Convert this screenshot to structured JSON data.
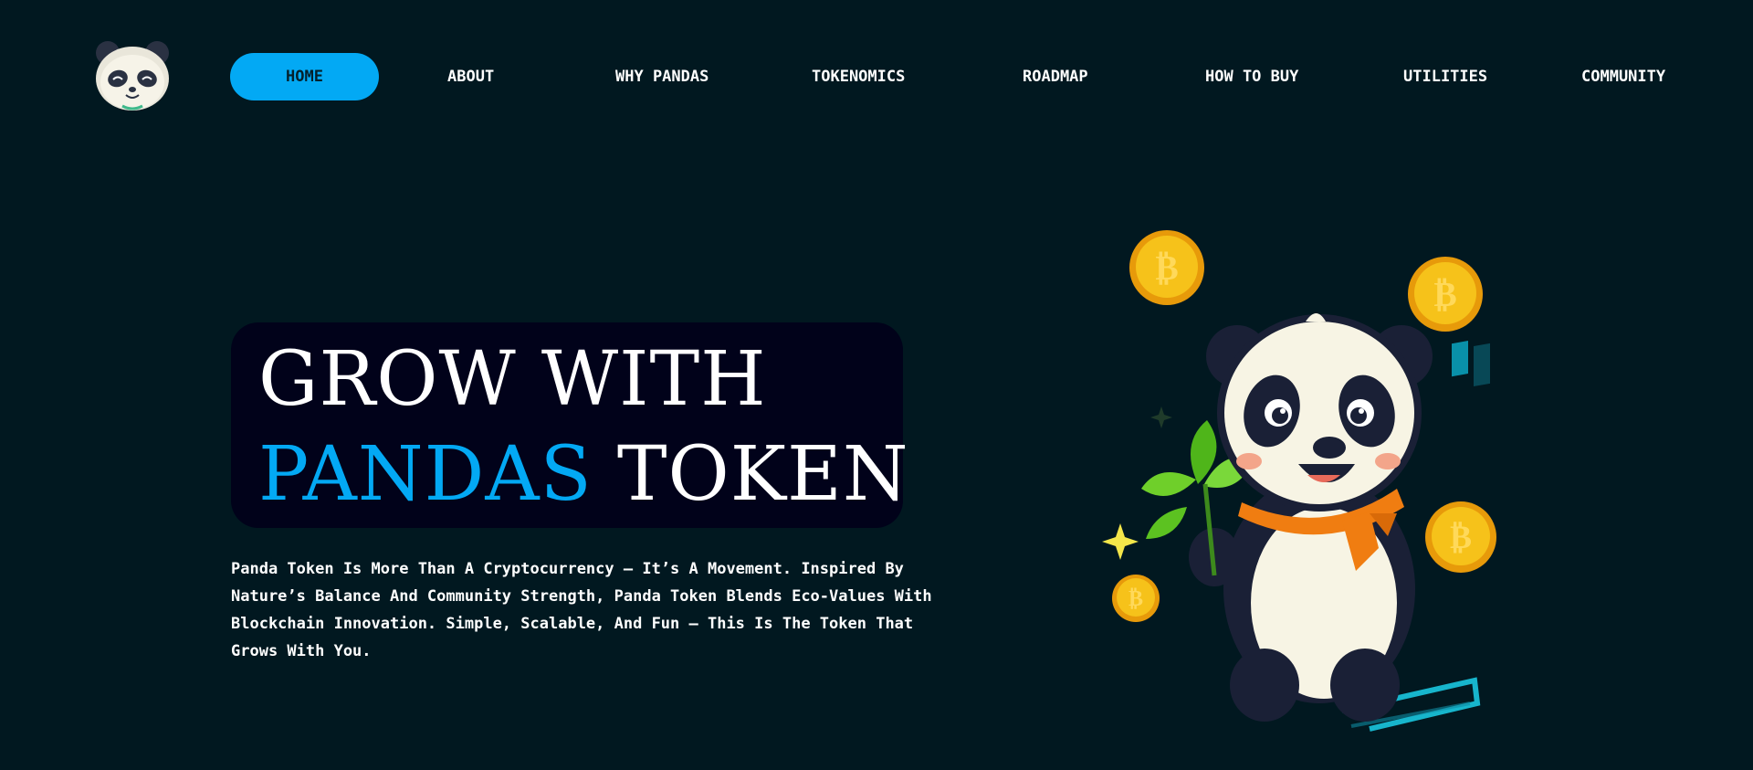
{
  "brand": {
    "logo_icon": "panda-face-icon"
  },
  "nav": {
    "items": [
      {
        "label": "HOME",
        "active": true
      },
      {
        "label": "ABOUT"
      },
      {
        "label": "WHY PANDAS"
      },
      {
        "label": "TOKENOMICS"
      },
      {
        "label": "ROADMAP"
      },
      {
        "label": "HOW TO BUY"
      },
      {
        "label": "UTILITIES"
      },
      {
        "label": "COMMUNITY"
      }
    ]
  },
  "hero": {
    "line1": "GROW WITH",
    "line2_accent": "PANDAS",
    "line2_rest": "TOKEN",
    "description": "Panda Token Is More Than A Cryptocurrency — It’s A Movement. Inspired By Nature’s Balance And Community Strength, Panda Token Blends Eco-Values With Blockchain Innovation. Simple, Scalable, And Fun — This Is The Token That Grows With You."
  },
  "illustration": {
    "main": "panda-mascot-icon",
    "coin_icon": "bitcoin-coin-icon",
    "coin_symbol": "₿"
  },
  "colors": {
    "background": "#011820",
    "accent": "#03a9f4",
    "hero_box": "#01021a",
    "coin": "#f6c21a"
  }
}
